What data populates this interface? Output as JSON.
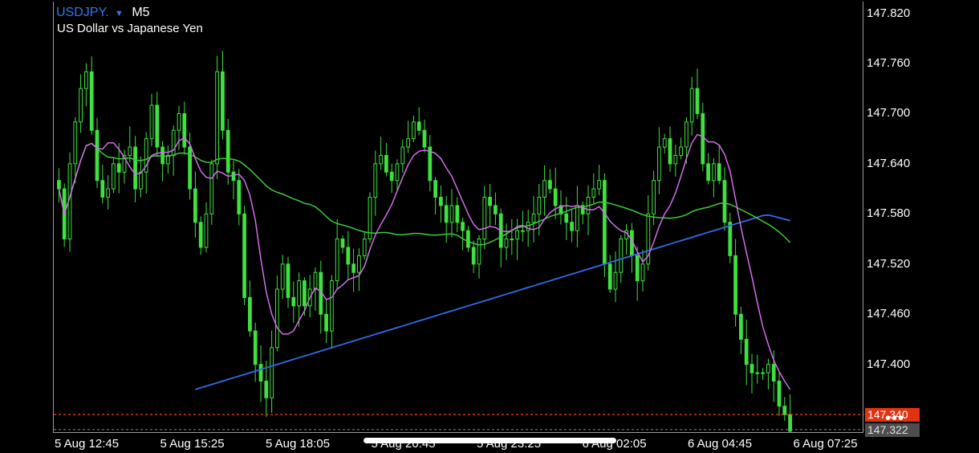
{
  "header": {
    "symbol": "USDJPY.",
    "dropdown_icon": "triangle-down-icon",
    "timeframe": "M5",
    "description": "US Dollar vs Japanese Yen"
  },
  "price_tags": {
    "bid": "147.340",
    "last": "147.322"
  },
  "more_menu": "•••",
  "colors": {
    "candle": "#3fe03f",
    "ma_fast": "#d26ee8",
    "ma_mid": "#3ccc3c",
    "ma_slow": "#2f6de8",
    "bid_line": "#ff3b1f",
    "last_line": "#8c8c8c",
    "background": "#000000"
  },
  "chart_data": {
    "type": "candlestick",
    "title": "USDJPY. M5",
    "subtitle": "US Dollar vs Japanese Yen",
    "ylim": [
      147.318,
      147.834
    ],
    "yticks": [
      "147.820",
      "147.760",
      "147.700",
      "147.640",
      "147.580",
      "147.520",
      "147.460",
      "147.400"
    ],
    "xticks": [
      "5 Aug 12:45",
      "5 Aug 15:25",
      "5 Aug 18:05",
      "5 Aug 20:45",
      "5 Aug 23:25",
      "6 Aug 02:05",
      "6 Aug 04:45",
      "6 Aug 07:25"
    ],
    "grid": false,
    "bid_price": 147.34,
    "last_price": 147.322,
    "close": [
      147.61,
      147.55,
      147.64,
      147.69,
      147.73,
      147.75,
      147.68,
      147.62,
      147.6,
      147.61,
      147.64,
      147.63,
      147.65,
      147.66,
      147.61,
      147.63,
      147.67,
      147.71,
      147.66,
      147.64,
      147.65,
      147.68,
      147.7,
      147.66,
      147.61,
      147.57,
      147.54,
      147.58,
      147.64,
      147.75,
      147.68,
      147.63,
      147.62,
      147.58,
      147.48,
      147.44,
      147.4,
      147.38,
      147.36,
      147.42,
      147.49,
      147.52,
      147.48,
      147.47,
      147.5,
      147.47,
      147.49,
      147.51,
      147.46,
      147.44,
      147.5,
      147.55,
      147.54,
      147.52,
      147.51,
      147.53,
      147.55,
      147.6,
      147.64,
      147.65,
      147.63,
      147.62,
      147.64,
      147.66,
      147.67,
      147.69,
      147.68,
      147.66,
      147.62,
      147.6,
      147.59,
      147.57,
      147.59,
      147.57,
      147.56,
      147.54,
      147.52,
      147.55,
      147.6,
      147.59,
      147.58,
      147.54,
      147.55,
      147.55,
      147.56,
      147.56,
      147.57,
      147.58,
      147.6,
      147.62,
      147.61,
      147.59,
      147.58,
      147.57,
      147.56,
      147.59,
      147.58,
      147.6,
      147.61,
      147.62,
      147.52,
      147.49,
      147.51,
      147.55,
      147.56,
      147.53,
      147.5,
      147.52,
      147.58,
      147.62,
      147.66,
      147.67,
      147.64,
      147.65,
      147.66,
      147.69,
      147.73,
      147.7,
      147.64,
      147.62,
      147.64,
      147.62,
      147.57,
      147.53,
      147.46,
      147.43,
      147.4,
      147.39,
      147.39,
      147.39,
      147.4,
      147.38,
      147.35,
      147.34,
      147.32
    ]
  }
}
